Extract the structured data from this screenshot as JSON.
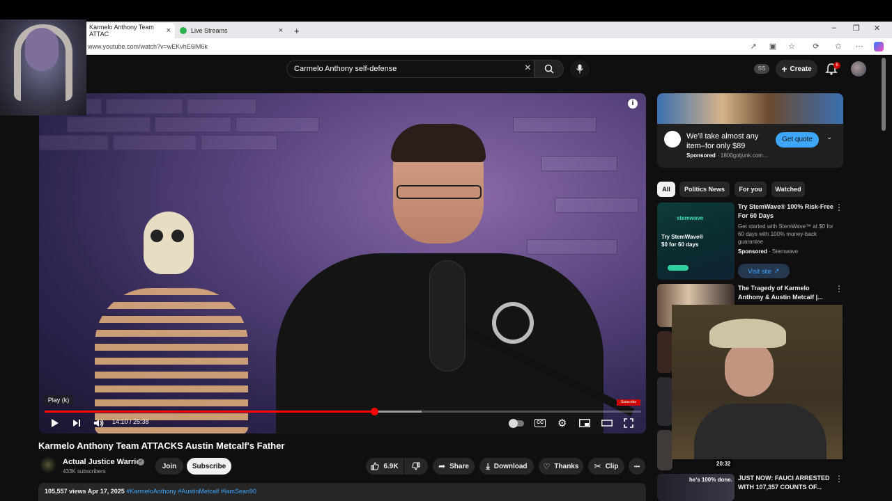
{
  "browser": {
    "tabs": [
      {
        "label": "Karmelo Anthony Team ATTAC",
        "active": true
      },
      {
        "label": "Live Streams",
        "active": false
      }
    ],
    "url": "www.youtube.com/watch?v=wEKvhE6lM6k",
    "new_tab": "+",
    "close_glyph": "×"
  },
  "header": {
    "search_query": "Carmelo Anthony self-defense",
    "ss_badge": "SS",
    "create_label": "Create",
    "notification_count": "6"
  },
  "player": {
    "tooltip": "Play (k)",
    "timecode": "14:10 / 25:38",
    "progress_played": 0.553,
    "progress_buffered": 0.632,
    "info_glyph": "i",
    "watermark": "Subscribe"
  },
  "video": {
    "title": "Karmelo Anthony Team ATTACKS Austin Metcalf's Father",
    "channel": "Actual Justice Warrior",
    "verified_glyph": "✓",
    "subscribers": "433K subscribers",
    "join_label": "Join",
    "subscribe_label": "Subscribe",
    "likes": "6.9K",
    "share_label": "Share",
    "download_label": "Download",
    "thanks_label": "Thanks",
    "clip_label": "Clip",
    "more_glyph": "•••"
  },
  "description": {
    "views": "105,557 views",
    "date": "Apr 17, 2025",
    "tags": "#KarmeloAnthony #AustinMetcalf #IamSean90"
  },
  "sidebar": {
    "ad": {
      "title": "We'll take almost any item–for only $89",
      "sponsored": "Sponsored",
      "domain": "1800gotjunk.com...",
      "cta": "Get quote",
      "chevron": "⌄"
    },
    "chips": [
      "All",
      "Politics News",
      "For you",
      "Watched"
    ],
    "items": [
      {
        "title": "Try StemWave® 100% Risk-Free For 60 Days",
        "desc": "Get started with StemWave™ at $0 for 60 days with 100% money-back guarantee",
        "sponsored": "Sponsored",
        "advertiser": "Stemwave",
        "cta": "Visit site",
        "thumb_text": "Try StemWave® $0 for 60 days",
        "thumb_brand": "stemwave"
      },
      {
        "title": "The Tragedy of Karmelo Anthony & Austin Metcalf |..."
      },
      {
        "title": "JUST NOW: FAUCI ARRESTED WITH 107,357 COUNTS OF...",
        "thumb_text": "he's 100% done."
      }
    ],
    "duration_badge": "20:32"
  },
  "colors": {
    "accent": "#ff0000",
    "link": "#3ea6ff",
    "background": "#0f0f0f",
    "chip": "#272727"
  },
  "icons": [
    "search-icon",
    "mic-icon",
    "bell-icon",
    "plus-icon",
    "play-icon",
    "next-icon",
    "volume-icon",
    "cc-icon",
    "settings-icon",
    "miniplayer-icon",
    "theater-icon",
    "fullscreen-icon",
    "like-icon",
    "dislike-icon",
    "share-icon",
    "download-icon",
    "thanks-icon",
    "clip-icon"
  ]
}
